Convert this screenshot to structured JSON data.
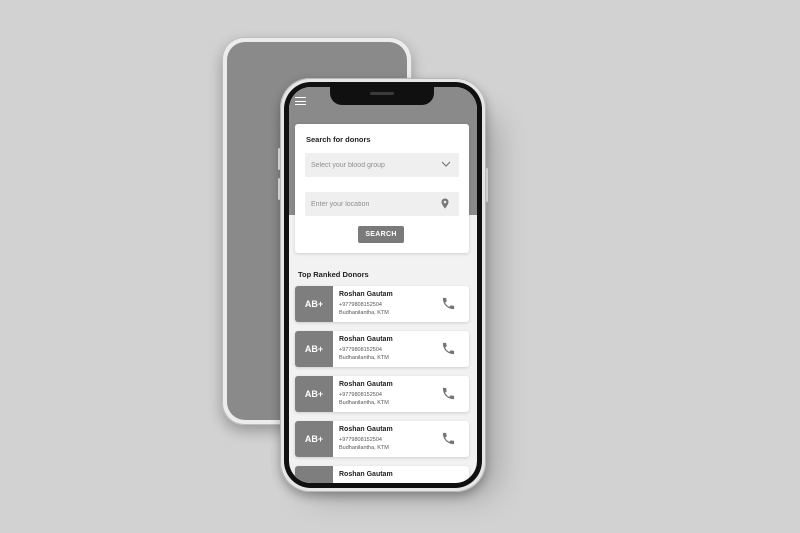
{
  "search": {
    "title": "Search for donors",
    "blood_group_placeholder": "Select your blood group",
    "location_placeholder": "Enter your location",
    "button_label": "SEARCH"
  },
  "top_donors": {
    "title": "Top Ranked Donors",
    "items": [
      {
        "blood": "AB+",
        "name": "Roshan Gautam",
        "phone": "+9779808152504",
        "location": "Budhanilantha, KTM"
      },
      {
        "blood": "AB+",
        "name": "Roshan Gautam",
        "phone": "+9779808152504",
        "location": "Budhanilantha, KTM"
      },
      {
        "blood": "AB+",
        "name": "Roshan Gautam",
        "phone": "+9779808152504",
        "location": "Budhanilantha, KTM"
      },
      {
        "blood": "AB+",
        "name": "Roshan Gautam",
        "phone": "+9779808152504",
        "location": "Budhanilantha, KTM"
      },
      {
        "blood": "",
        "name": "Roshan Gautam",
        "phone": "",
        "location": ""
      }
    ]
  },
  "icons": {
    "menu": "hamburger-menu-icon",
    "dropdown": "chevron-down-icon",
    "location": "map-pin-icon",
    "call": "phone-icon"
  },
  "colors": {
    "background": "#d2d2d2",
    "header_band": "#8a8a8a",
    "blood_badge": "#7e7e7e",
    "button": "#7a7a7a"
  }
}
